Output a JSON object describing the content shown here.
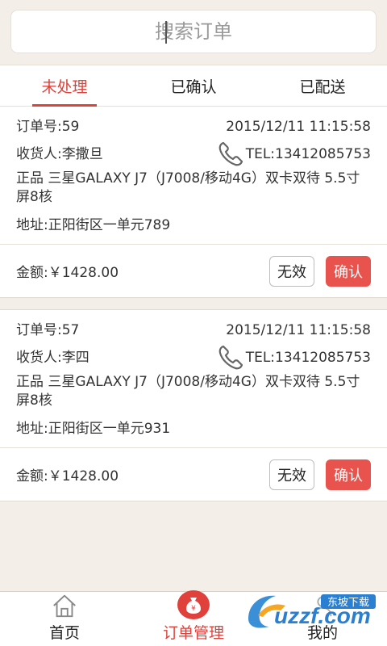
{
  "search": {
    "placeholder": "搜索订单"
  },
  "tabs": [
    {
      "label": "未处理",
      "active": true
    },
    {
      "label": "已确认",
      "active": false
    },
    {
      "label": "已配送",
      "active": false
    }
  ],
  "orders": [
    {
      "order_no": "订单号:59",
      "datetime": "2015/12/11 11:15:58",
      "recipient": "收货人:李撒旦",
      "tel": "TEL:13412085753",
      "product": "正品 三星GALAXY J7（J7008/移动4G）双卡双待 5.5寸屏8核",
      "address": "地址:正阳街区一单元789",
      "amount": "金额:￥1428.00",
      "invalid_label": "无效",
      "confirm_label": "确认"
    },
    {
      "order_no": "订单号:57",
      "datetime": "2015/12/11 11:15:58",
      "recipient": "收货人:李四",
      "tel": "TEL:13412085753",
      "product": "正品 三星GALAXY J7（J7008/移动4G）双卡双待 5.5寸屏8核",
      "address": "地址:正阳街区一单元931",
      "amount": "金额:￥1428.00",
      "invalid_label": "无效",
      "confirm_label": "确认"
    }
  ],
  "bottom_nav": [
    {
      "label": "首页",
      "icon": "home-icon",
      "active": false
    },
    {
      "label": "订单管理",
      "icon": "money-bag-icon",
      "active": true
    },
    {
      "label": "我的",
      "icon": "user-icon",
      "active": false
    }
  ],
  "watermark": {
    "text": "uzzf.com",
    "subtext": "东坡下载"
  },
  "colors": {
    "accent": "#e0413a",
    "confirm_button": "#e9534d",
    "background": "#f3efe8"
  }
}
